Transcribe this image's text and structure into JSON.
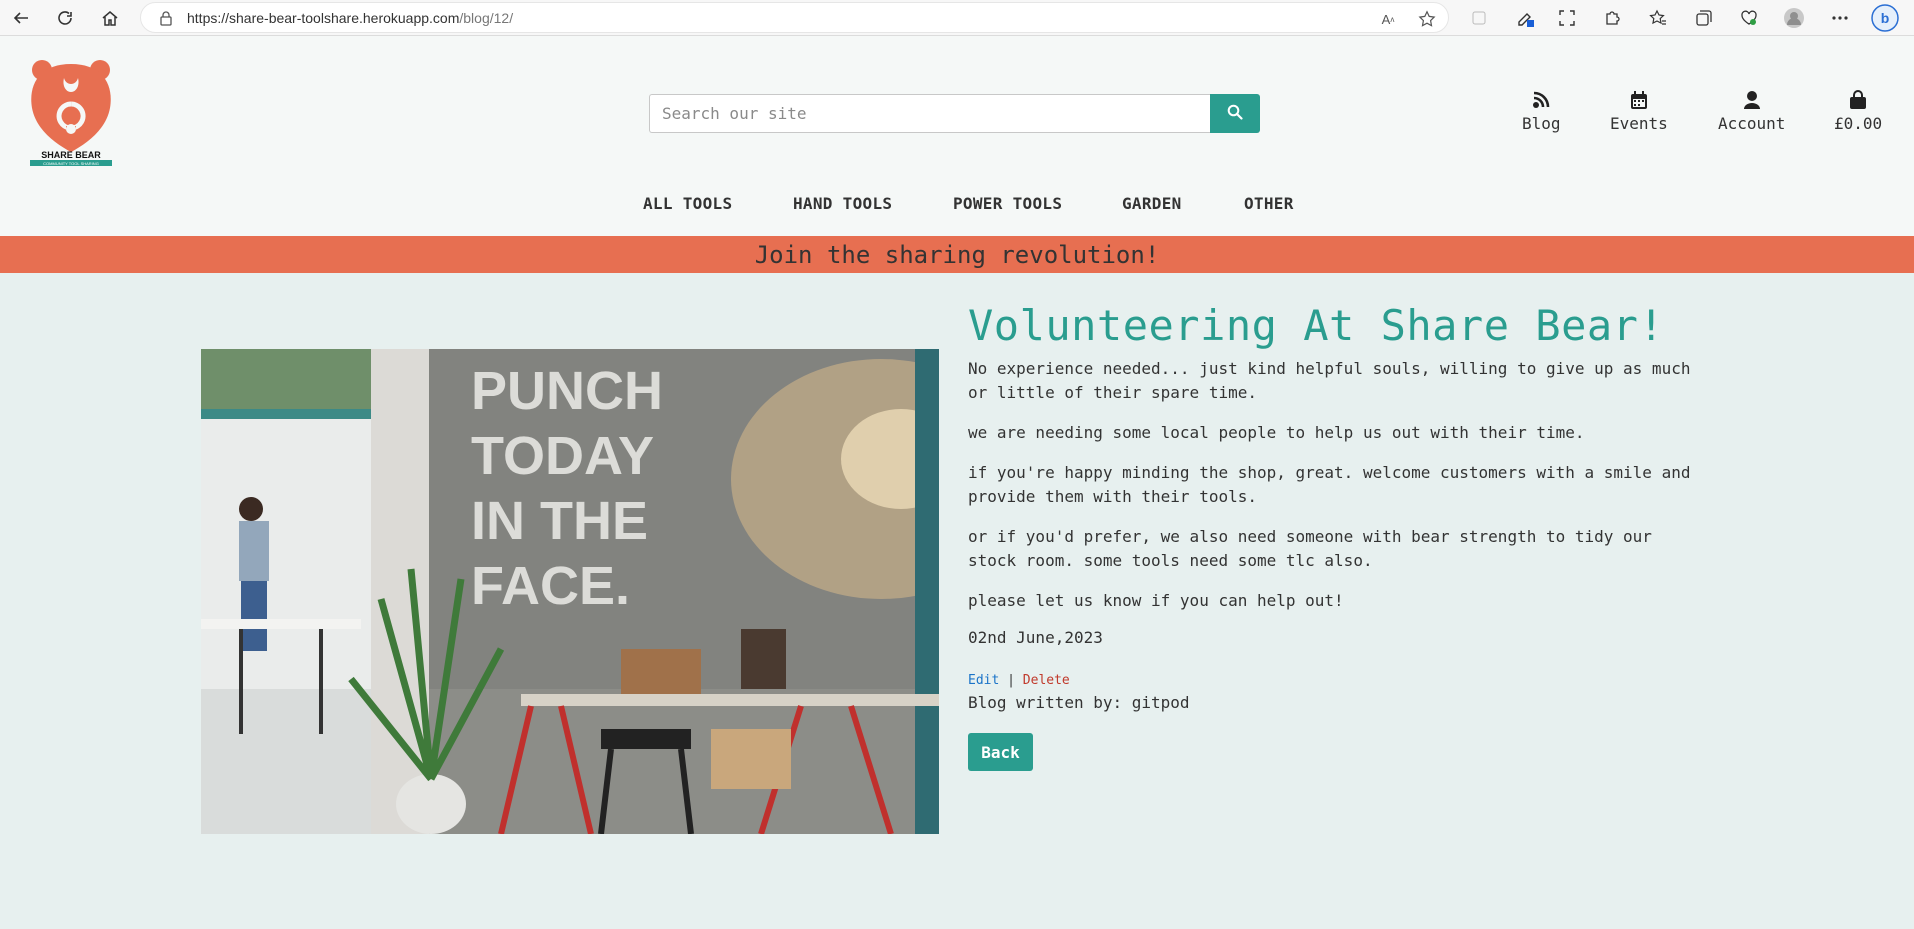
{
  "browser": {
    "url_host": "https://share-bear-toolshare.herokuapp.com",
    "url_path": "/blog/12/",
    "read_aloud_label": "A"
  },
  "site": {
    "logo_text": "SHARE BEAR",
    "logo_subtext": "COMMUNITY TOOL SHARING",
    "search_placeholder": "Search our site",
    "header_links": {
      "blog": "Blog",
      "events": "Events",
      "account": "Account",
      "basket": "£0.00"
    },
    "nav": [
      "ALL TOOLS",
      "HAND TOOLS",
      "POWER TOOLS",
      "GARDEN",
      "OTHER"
    ],
    "banner": "Join the sharing revolution!"
  },
  "post": {
    "image_text_lines": [
      "PUNCH",
      "TODAY",
      "IN THE",
      "FACE."
    ],
    "title": "Volunteering At Share Bear!",
    "paragraphs": [
      "No experience needed... just kind helpful souls, willing to give up as much or little of their spare time.",
      "we are needing some local people to help us out with their time.",
      "if you're happy minding the shop, great. welcome customers with a smile and provide them with their tools.",
      "or if you'd prefer, we also need someone with bear strength to tidy our stock room. some tools need some tlc also.",
      "please let us know if you can help out!"
    ],
    "date": "02nd June,2023",
    "edit_label": "Edit",
    "separator": "|",
    "delete_label": "Delete",
    "author_line": "Blog written by: gitpod",
    "back_label": "Back"
  },
  "colors": {
    "accent": "#2a9d8f",
    "banner": "#e76f51",
    "page_bg": "#e7f0ef"
  }
}
